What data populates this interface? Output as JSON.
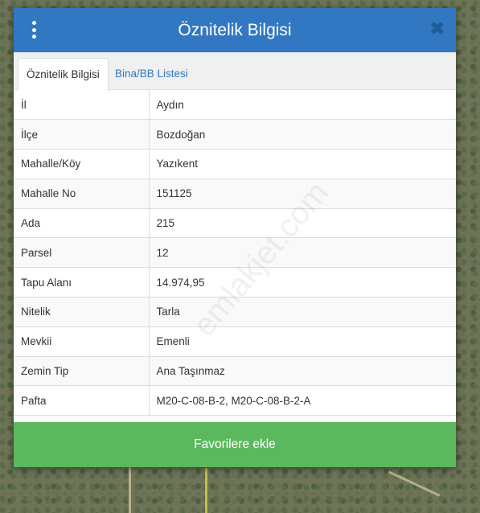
{
  "modal": {
    "title": "Öznitelik Bilgisi",
    "close_symbol": "✖",
    "menu_icon": "vertical-ellipsis-icon"
  },
  "tabs": [
    {
      "label": "Öznitelik Bilgisi",
      "active": true
    },
    {
      "label": "Bina/BB Listesi",
      "active": false
    }
  ],
  "rows": [
    {
      "key": "İl",
      "value": "Aydın"
    },
    {
      "key": "İlçe",
      "value": "Bozdoğan"
    },
    {
      "key": "Mahalle/Köy",
      "value": "Yazıkent"
    },
    {
      "key": "Mahalle No",
      "value": "151125"
    },
    {
      "key": "Ada",
      "value": "215"
    },
    {
      "key": "Parsel",
      "value": "12"
    },
    {
      "key": "Tapu Alanı",
      "value": "14.974,95"
    },
    {
      "key": "Nitelik",
      "value": "Tarla"
    },
    {
      "key": "Mevkii",
      "value": "Emenli"
    },
    {
      "key": "Zemin Tip",
      "value": "Ana Taşınmaz"
    },
    {
      "key": "Pafta",
      "value": "M20-C-08-B-2, M20-C-08-B-2-A"
    }
  ],
  "footer": {
    "favorite_label": "Favorilere ekle"
  },
  "watermark": "emlakjet.com",
  "colors": {
    "header": "#3277c1",
    "favorite_button": "#5cb85c"
  }
}
